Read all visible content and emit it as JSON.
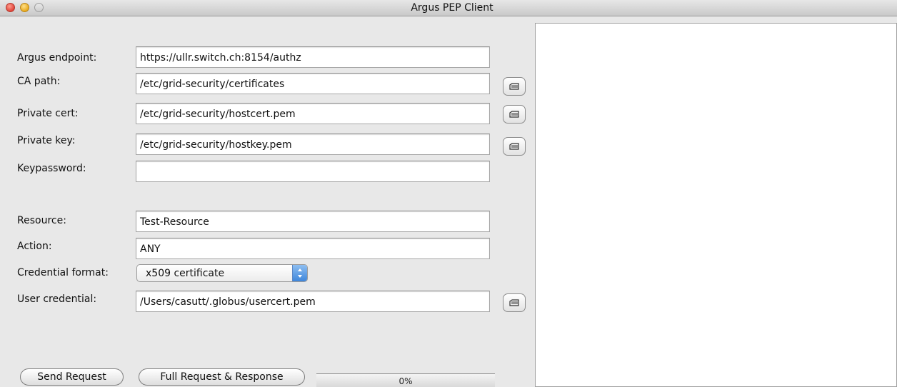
{
  "window": {
    "title": "Argus PEP Client"
  },
  "form": {
    "endpoint": {
      "label": "Argus endpoint:",
      "value": "https://ullr.switch.ch:8154/authz"
    },
    "ca_path": {
      "label": "CA path:",
      "value": "/etc/grid-security/certificates"
    },
    "private_cert": {
      "label": "Private cert:",
      "value": "/etc/grid-security/hostcert.pem"
    },
    "private_key": {
      "label": "Private key:",
      "value": "/etc/grid-security/hostkey.pem"
    },
    "keypassword": {
      "label": "Keypassword:",
      "value": ""
    },
    "resource": {
      "label": "Resource:",
      "value": "Test-Resource"
    },
    "action": {
      "label": "Action:",
      "value": "ANY"
    },
    "credential_format": {
      "label": "Credential format:",
      "value": "x509 certificate"
    },
    "user_credential": {
      "label": "User credential:",
      "value": "/Users/casutt/.globus/usercert.pem"
    }
  },
  "buttons": {
    "send_request": "Send Request",
    "full_request": "Full Request & Response"
  },
  "progress": {
    "text": "0%",
    "value": 0
  },
  "icons": {
    "browse": "folder-icon"
  }
}
